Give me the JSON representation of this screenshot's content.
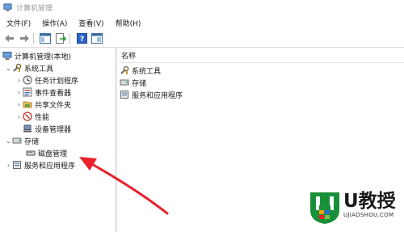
{
  "window": {
    "title": "计算机管理"
  },
  "menu": [
    "文件(F)",
    "操作(A)",
    "查看(V)",
    "帮助(H)"
  ],
  "tree": {
    "root": "计算机管理(本地)",
    "system_tools": "系统工具",
    "task_scheduler": "任务计划程序",
    "event_viewer": "事件查看器",
    "shared_folders": "共享文件夹",
    "performance": "性能",
    "device_manager": "设备管理器",
    "storage": "存储",
    "disk_management": "磁盘管理",
    "services_apps": "服务和应用程序"
  },
  "list": {
    "column_name": "名称",
    "items": [
      "系统工具",
      "存储",
      "服务和应用程序"
    ]
  },
  "watermark": {
    "brand": "U教授",
    "url": "UJIAOSHOU.COM"
  },
  "colors": {
    "annotation_arrow": "#e8202a",
    "watermark_green": "#1a8f3a"
  }
}
